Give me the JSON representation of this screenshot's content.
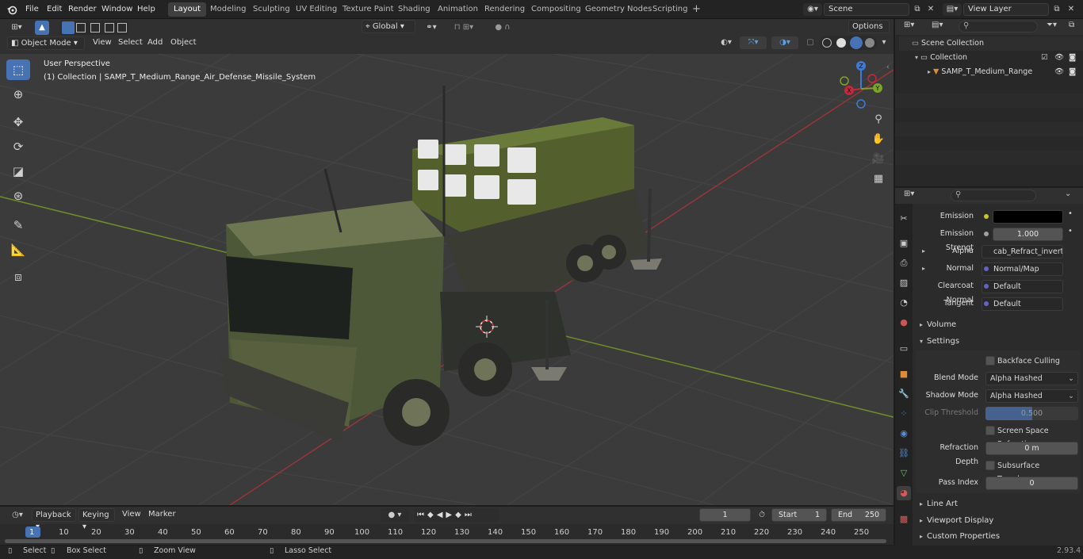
{
  "menubar": {
    "items": [
      "File",
      "Edit",
      "Render",
      "Window",
      "Help"
    ],
    "workspaces": [
      "Layout",
      "Modeling",
      "Sculpting",
      "UV Editing",
      "Texture Paint",
      "Shading",
      "Animation",
      "Rendering",
      "Compositing",
      "Geometry Nodes",
      "Scripting"
    ],
    "active_workspace": "Layout",
    "add_tab": "+",
    "scene": "Scene",
    "view_layer": "View Layer"
  },
  "viewport_header": {
    "mode": "Object Mode",
    "menus": [
      "View",
      "Select",
      "Add",
      "Object"
    ],
    "orientation": "Global",
    "options": "Options"
  },
  "viewport": {
    "view_name": "User Perspective",
    "collection_info": "(1) Collection | SAMP_T_Medium_Range_Air_Defense_Missile_System",
    "gizmo": {
      "x": "X",
      "y": "Y",
      "z": "Z"
    }
  },
  "outliner": {
    "rows": [
      "Scene Collection",
      "Collection",
      "SAMP_T_Medium_Range"
    ]
  },
  "properties": {
    "rows": [
      {
        "label": "Emission",
        "value": ""
      },
      {
        "label": "Emission Strengt",
        "value": "1.000"
      },
      {
        "label": "Alpha",
        "value": "cab_Refract_invert.p..."
      },
      {
        "label": "Normal",
        "value": "Normal/Map"
      },
      {
        "label": "Clearcoat Normal",
        "value": "Default"
      },
      {
        "label": "Tangent",
        "value": "Default"
      }
    ],
    "panels": {
      "volume": "Volume",
      "settings": "Settings",
      "line_art": "Line Art",
      "viewport_display": "Viewport Display",
      "custom_properties": "Custom Properties"
    },
    "settings": {
      "backface_culling": "Backface Culling",
      "blend_mode_label": "Blend Mode",
      "blend_mode": "Alpha Hashed",
      "shadow_mode_label": "Shadow Mode",
      "shadow_mode": "Alpha Hashed",
      "clip_threshold_label": "Clip Threshold",
      "clip_threshold": "0.500",
      "screen_space_refraction": "Screen Space Refraction",
      "refraction_depth_label": "Refraction Depth",
      "refraction_depth": "0 m",
      "subsurface_translucency": "Subsurface Translucency",
      "pass_index_label": "Pass Index",
      "pass_index": "0"
    }
  },
  "timeline": {
    "menus": [
      "Playback",
      "Keying",
      "View",
      "Marker"
    ],
    "current_frame": "1",
    "start_label": "Start",
    "start": "1",
    "end_label": "End",
    "end": "250",
    "ticks": [
      "1",
      "10",
      "20",
      "30",
      "40",
      "50",
      "60",
      "70",
      "80",
      "90",
      "100",
      "110",
      "120",
      "130",
      "140",
      "150",
      "160",
      "170",
      "180",
      "190",
      "200",
      "210",
      "220",
      "230",
      "240",
      "250"
    ]
  },
  "statusbar": {
    "select": "Select",
    "box_select": "Box Select",
    "zoom_view": "Zoom View",
    "lasso_select": "Lasso Select",
    "version": "2.93.4"
  },
  "colors": {
    "accent": "#4772b3",
    "x_axis": "#c5283c",
    "y_axis": "#7ca32a",
    "z_axis": "#3f7bd6"
  }
}
